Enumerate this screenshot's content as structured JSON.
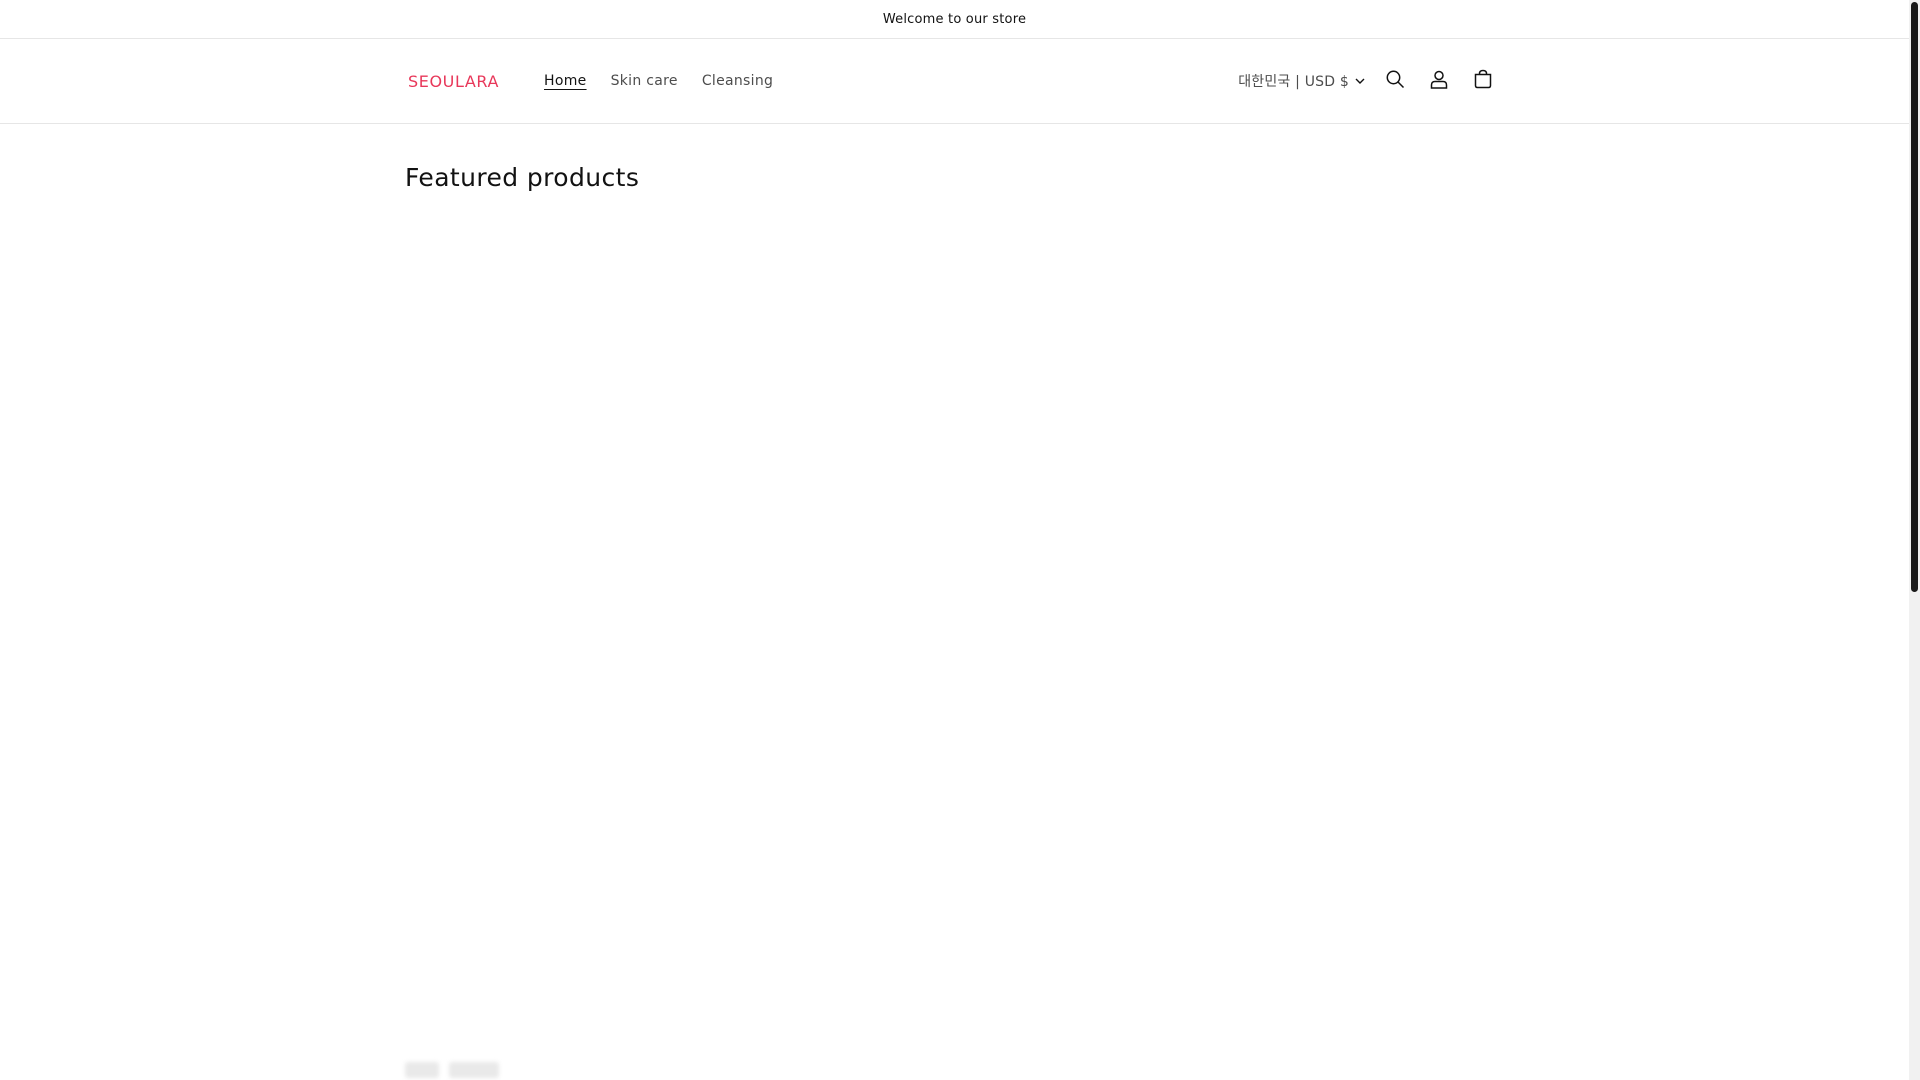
{
  "announcement": {
    "text": "Welcome to our store"
  },
  "header": {
    "logo": "SEOULARA",
    "nav": [
      {
        "label": "Home",
        "active": true
      },
      {
        "label": "Skin care",
        "active": false
      },
      {
        "label": "Cleansing",
        "active": false
      }
    ],
    "locale_label": "대한민국 | USD $",
    "icons": [
      "search-icon",
      "account-icon",
      "cart-icon"
    ]
  },
  "main": {
    "section_title": "Featured products"
  },
  "colors": {
    "brand": "#e8385a",
    "text": "#121212",
    "muted": "#4d4d4d",
    "border": "#e6e6e6"
  }
}
